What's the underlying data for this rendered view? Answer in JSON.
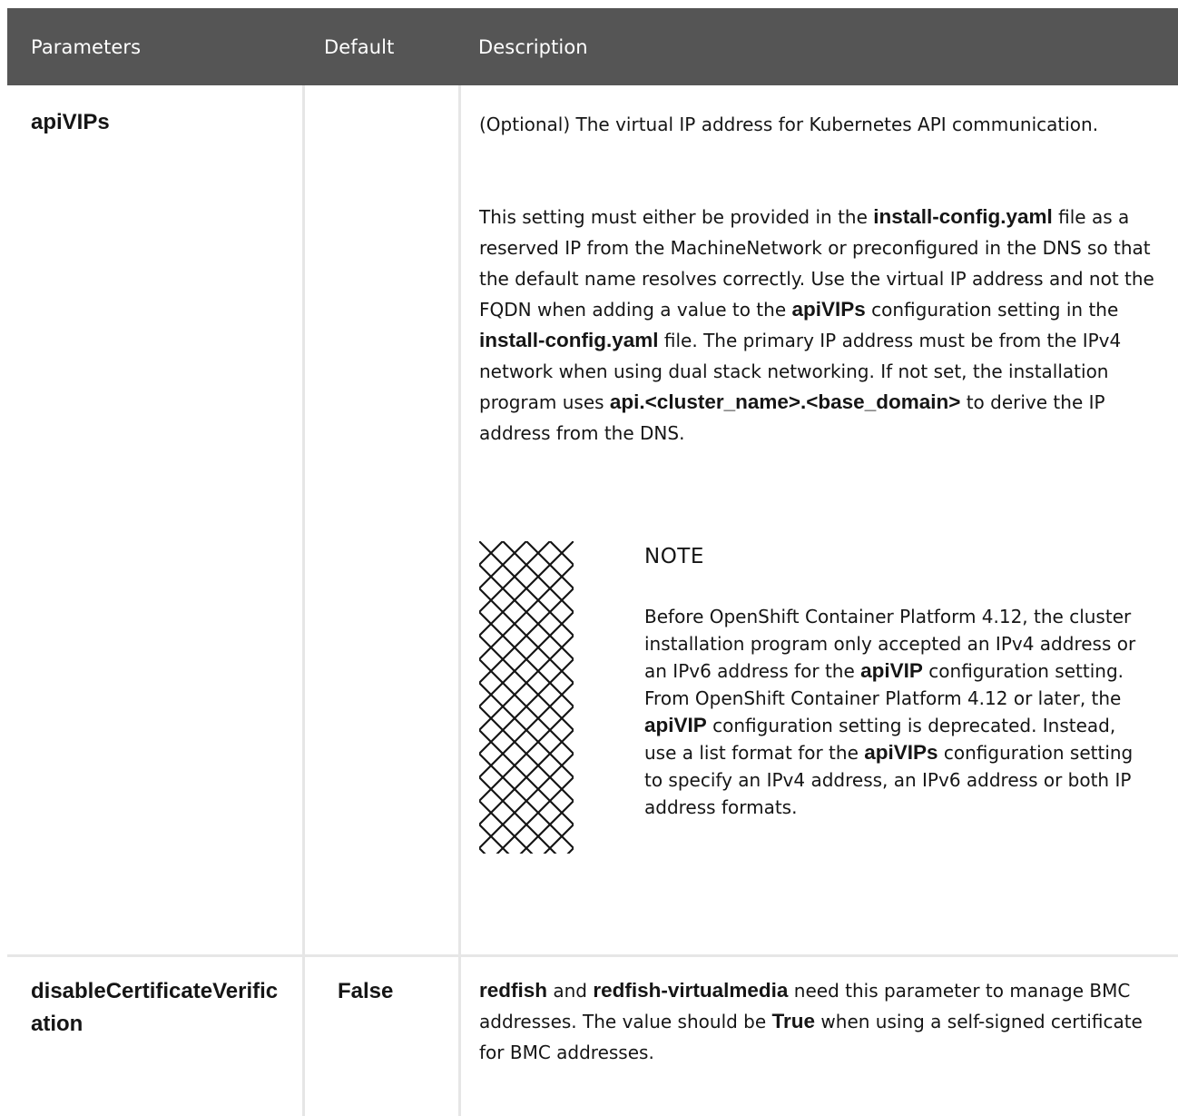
{
  "header": {
    "parameters": "Parameters",
    "default": "Default",
    "description": "Description"
  },
  "rows": [
    {
      "parameter": "apiVIPs",
      "default": "",
      "paragraph1": "(Optional) The virtual IP address for Kubernetes API communication.",
      "paragraph2": {
        "t1": "This setting must either be provided in the ",
        "k1": "install-config.yaml",
        "t2": " file as a reserved IP from the MachineNetwork or preconfigured in the DNS so that the default name resolves correctly. Use the virtual IP address and not the FQDN when adding a value to the ",
        "k2": "apiVIPs",
        "t3": " configuration setting in the ",
        "k3": "install-config.yaml",
        "t4": " file. The primary IP address must be from the IPv4 network when using dual stack networking. If not set, the installation program uses ",
        "k4": "api.<cluster_name>.<base_domain>",
        "t5": " to derive the IP address from the DNS."
      },
      "note": {
        "title": "NOTE",
        "t1": "Before OpenShift Container Platform 4.12, the cluster installation program only accepted an IPv4 address or an IPv6 address for the ",
        "k1": "apiVIP",
        "t2": " configuration setting. From OpenShift Container Platform 4.12 or later, the ",
        "k2": "apiVIP",
        "t3": " configuration setting is deprecated. Instead, use a list format for the ",
        "k3": "apiVIPs",
        "t4": " configuration setting to specify an IPv4 address, an IPv6 address or both IP address formats."
      }
    },
    {
      "parameter": "disableCertificateVerification",
      "default": "False",
      "description": {
        "k1": "redfish",
        "t1": " and ",
        "k2": "redfish-virtualmedia",
        "t2": " need this parameter to manage BMC addresses. The value should be ",
        "k3": "True",
        "t3": " when using a self-signed certificate for BMC addresses."
      }
    }
  ]
}
